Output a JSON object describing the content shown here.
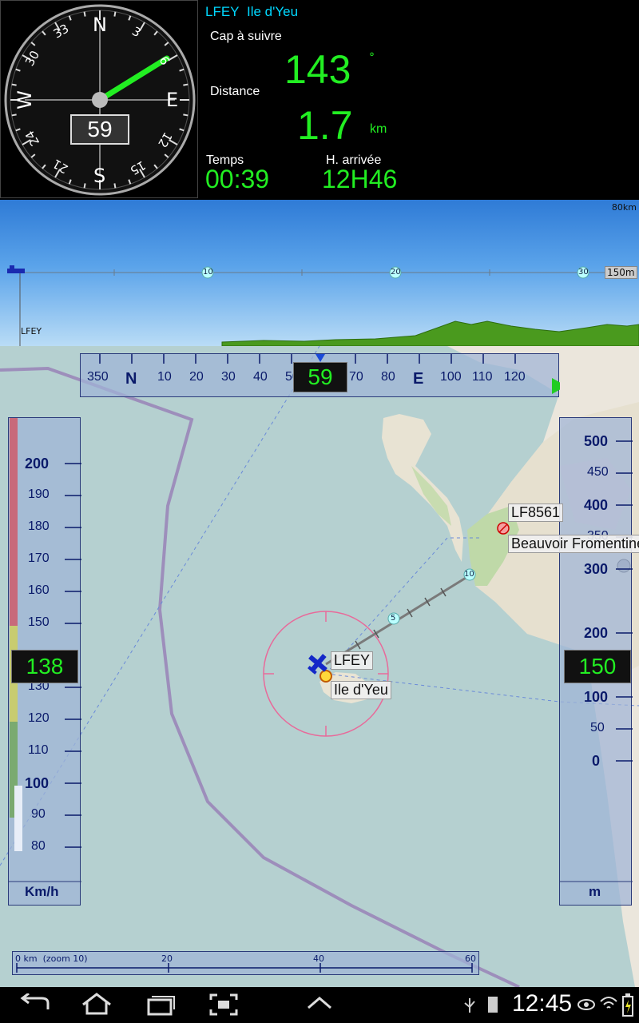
{
  "waypoint": {
    "code": "LFEY",
    "name": "Ile d'Yeu"
  },
  "compass": {
    "heading_value": "59",
    "cardinals": {
      "n": "N",
      "e": "E",
      "s": "S",
      "w": "W"
    },
    "ticks": [
      "3",
      "6",
      "12",
      "15",
      "21",
      "24",
      "30",
      "33"
    ]
  },
  "nav": {
    "cap_label": "Cap à suivre",
    "cap_value": "143",
    "cap_unit": "°",
    "distance_label": "Distance",
    "distance_value": "1.7",
    "distance_unit": "km",
    "temps_label": "Temps",
    "temps_value": "00:39",
    "arrivee_label": "H. arrivée",
    "arrivee_value": "12H46"
  },
  "profile": {
    "range_label": "80km",
    "altitude_label": "150m",
    "marks": [
      "10",
      "20",
      "30"
    ],
    "origin_label": "LFEY"
  },
  "heading_tape": {
    "labels": [
      "350",
      "N",
      "10",
      "20",
      "30",
      "40",
      "50",
      "70",
      "80",
      "E",
      "100",
      "110",
      "120"
    ],
    "value": "59"
  },
  "speed_tape": {
    "labels": [
      "200",
      "190",
      "180",
      "170",
      "160",
      "150",
      "130",
      "120",
      "110",
      "100",
      "90",
      "80"
    ],
    "value": "138",
    "unit": "Km/h"
  },
  "alt_tape": {
    "labels": [
      "500",
      "450",
      "400",
      "350",
      "300",
      "200",
      "100",
      "50",
      "0"
    ],
    "value": "150",
    "unit": "m"
  },
  "map_labels": {
    "lfey": "LFEY",
    "ile": "Ile d'Yeu",
    "lf8561": "LF8561",
    "beauvoir": "Beauvoir Fromentine",
    "route_5": "5",
    "route_10": "10"
  },
  "scale": {
    "zero": "0 km  (zoom 10)",
    "m20": "20",
    "m40": "40",
    "m60": "60"
  },
  "status": {
    "time": "12:45"
  },
  "colors": {
    "accent_green": "#22ee22",
    "cyan": "#00d8ff",
    "tape_text": "#0a1a6a"
  }
}
